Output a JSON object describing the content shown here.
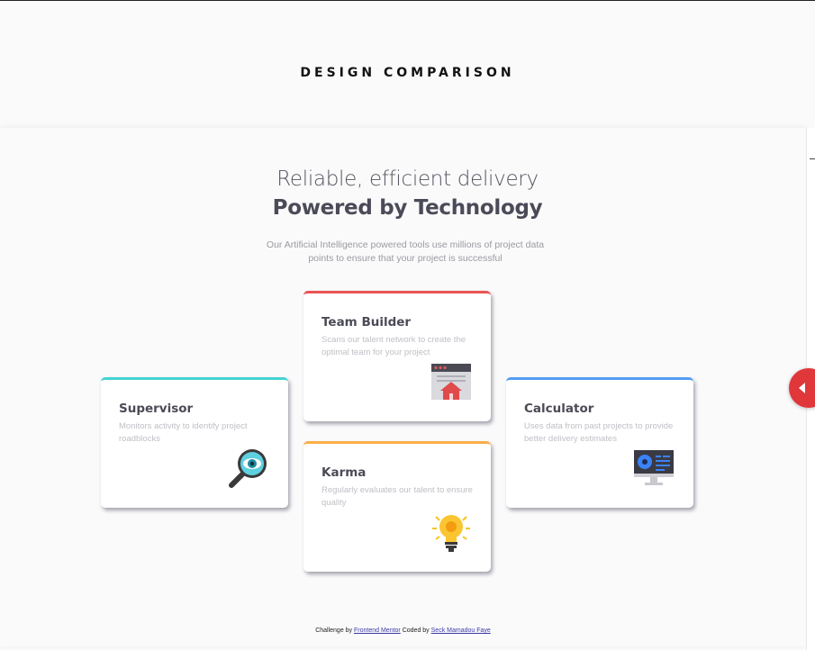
{
  "header": {
    "title": "DESIGN COMPARISON"
  },
  "hero": {
    "line1": "Reliable, efficient delivery",
    "line2": "Powered by Technology",
    "intro": "Our Artificial Intelligence powered tools use millions of project data points to ensure that your project is successful"
  },
  "cards": [
    {
      "title": "Supervisor",
      "text": "Monitors activity to identify project roadblocks",
      "accent": "#44d3d2",
      "icon": "magnifier-eye-icon"
    },
    {
      "title": "Team Builder",
      "text": "Scans our talent network to create the optimal team for your project",
      "accent": "#ea5454",
      "icon": "team-builder-icon"
    },
    {
      "title": "Karma",
      "text": "Regularly evaluates our talent to ensure quality",
      "accent": "#fcae4a",
      "icon": "lightbulb-icon"
    },
    {
      "title": "Calculator",
      "text": "Uses data from past projects to provide better delivery estimates",
      "accent": "#549ef2",
      "icon": "monitor-icon"
    }
  ],
  "footer": {
    "prefix": "Challenge by",
    "link1": "Frontend Mentor",
    "middle": "Coded by",
    "link2": "Seck Mamadou Faye"
  }
}
